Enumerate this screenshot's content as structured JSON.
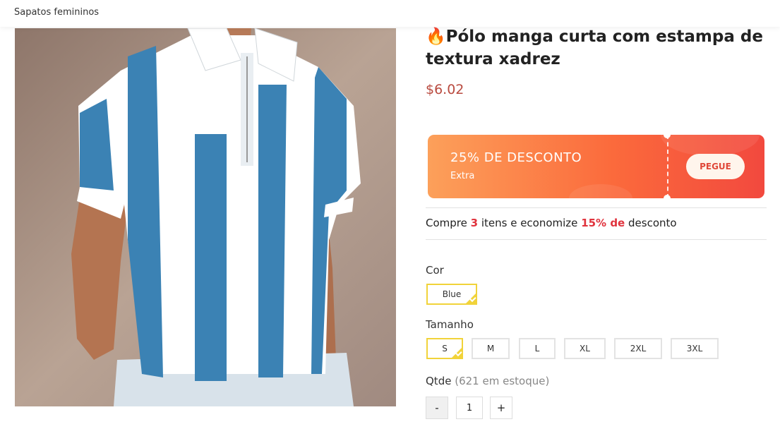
{
  "breadcrumb": {
    "label": "Sapatos femininos"
  },
  "product": {
    "title_icon": "🔥",
    "title": "Pólo manga curta com estampa de textura xadrez",
    "price": "$6.02"
  },
  "coupon": {
    "headline": "25% DE DESCONTO",
    "sub": "Extra",
    "button": "PEGUE",
    "colors": {
      "start": "#fca05a",
      "end": "#f2493e"
    }
  },
  "promo": {
    "prefix": "Compre ",
    "qty": "3",
    "middle": " itens e economize ",
    "pct": "15% de",
    "suffix": " desconto"
  },
  "color": {
    "label": "Cor",
    "options": [
      "Blue"
    ],
    "selected": "Blue"
  },
  "size": {
    "label": "Tamanho",
    "options": [
      "S",
      "M",
      "L",
      "XL",
      "2XL",
      "3XL"
    ],
    "selected": "S"
  },
  "quantity": {
    "label": "Qtde",
    "stock": "(621 em estoque)",
    "minus": "-",
    "value": "1",
    "plus": "+"
  },
  "accent_colors": {
    "price": "#b94a3f",
    "highlight": "#e0333d",
    "selected_border": "#f1d33a"
  }
}
